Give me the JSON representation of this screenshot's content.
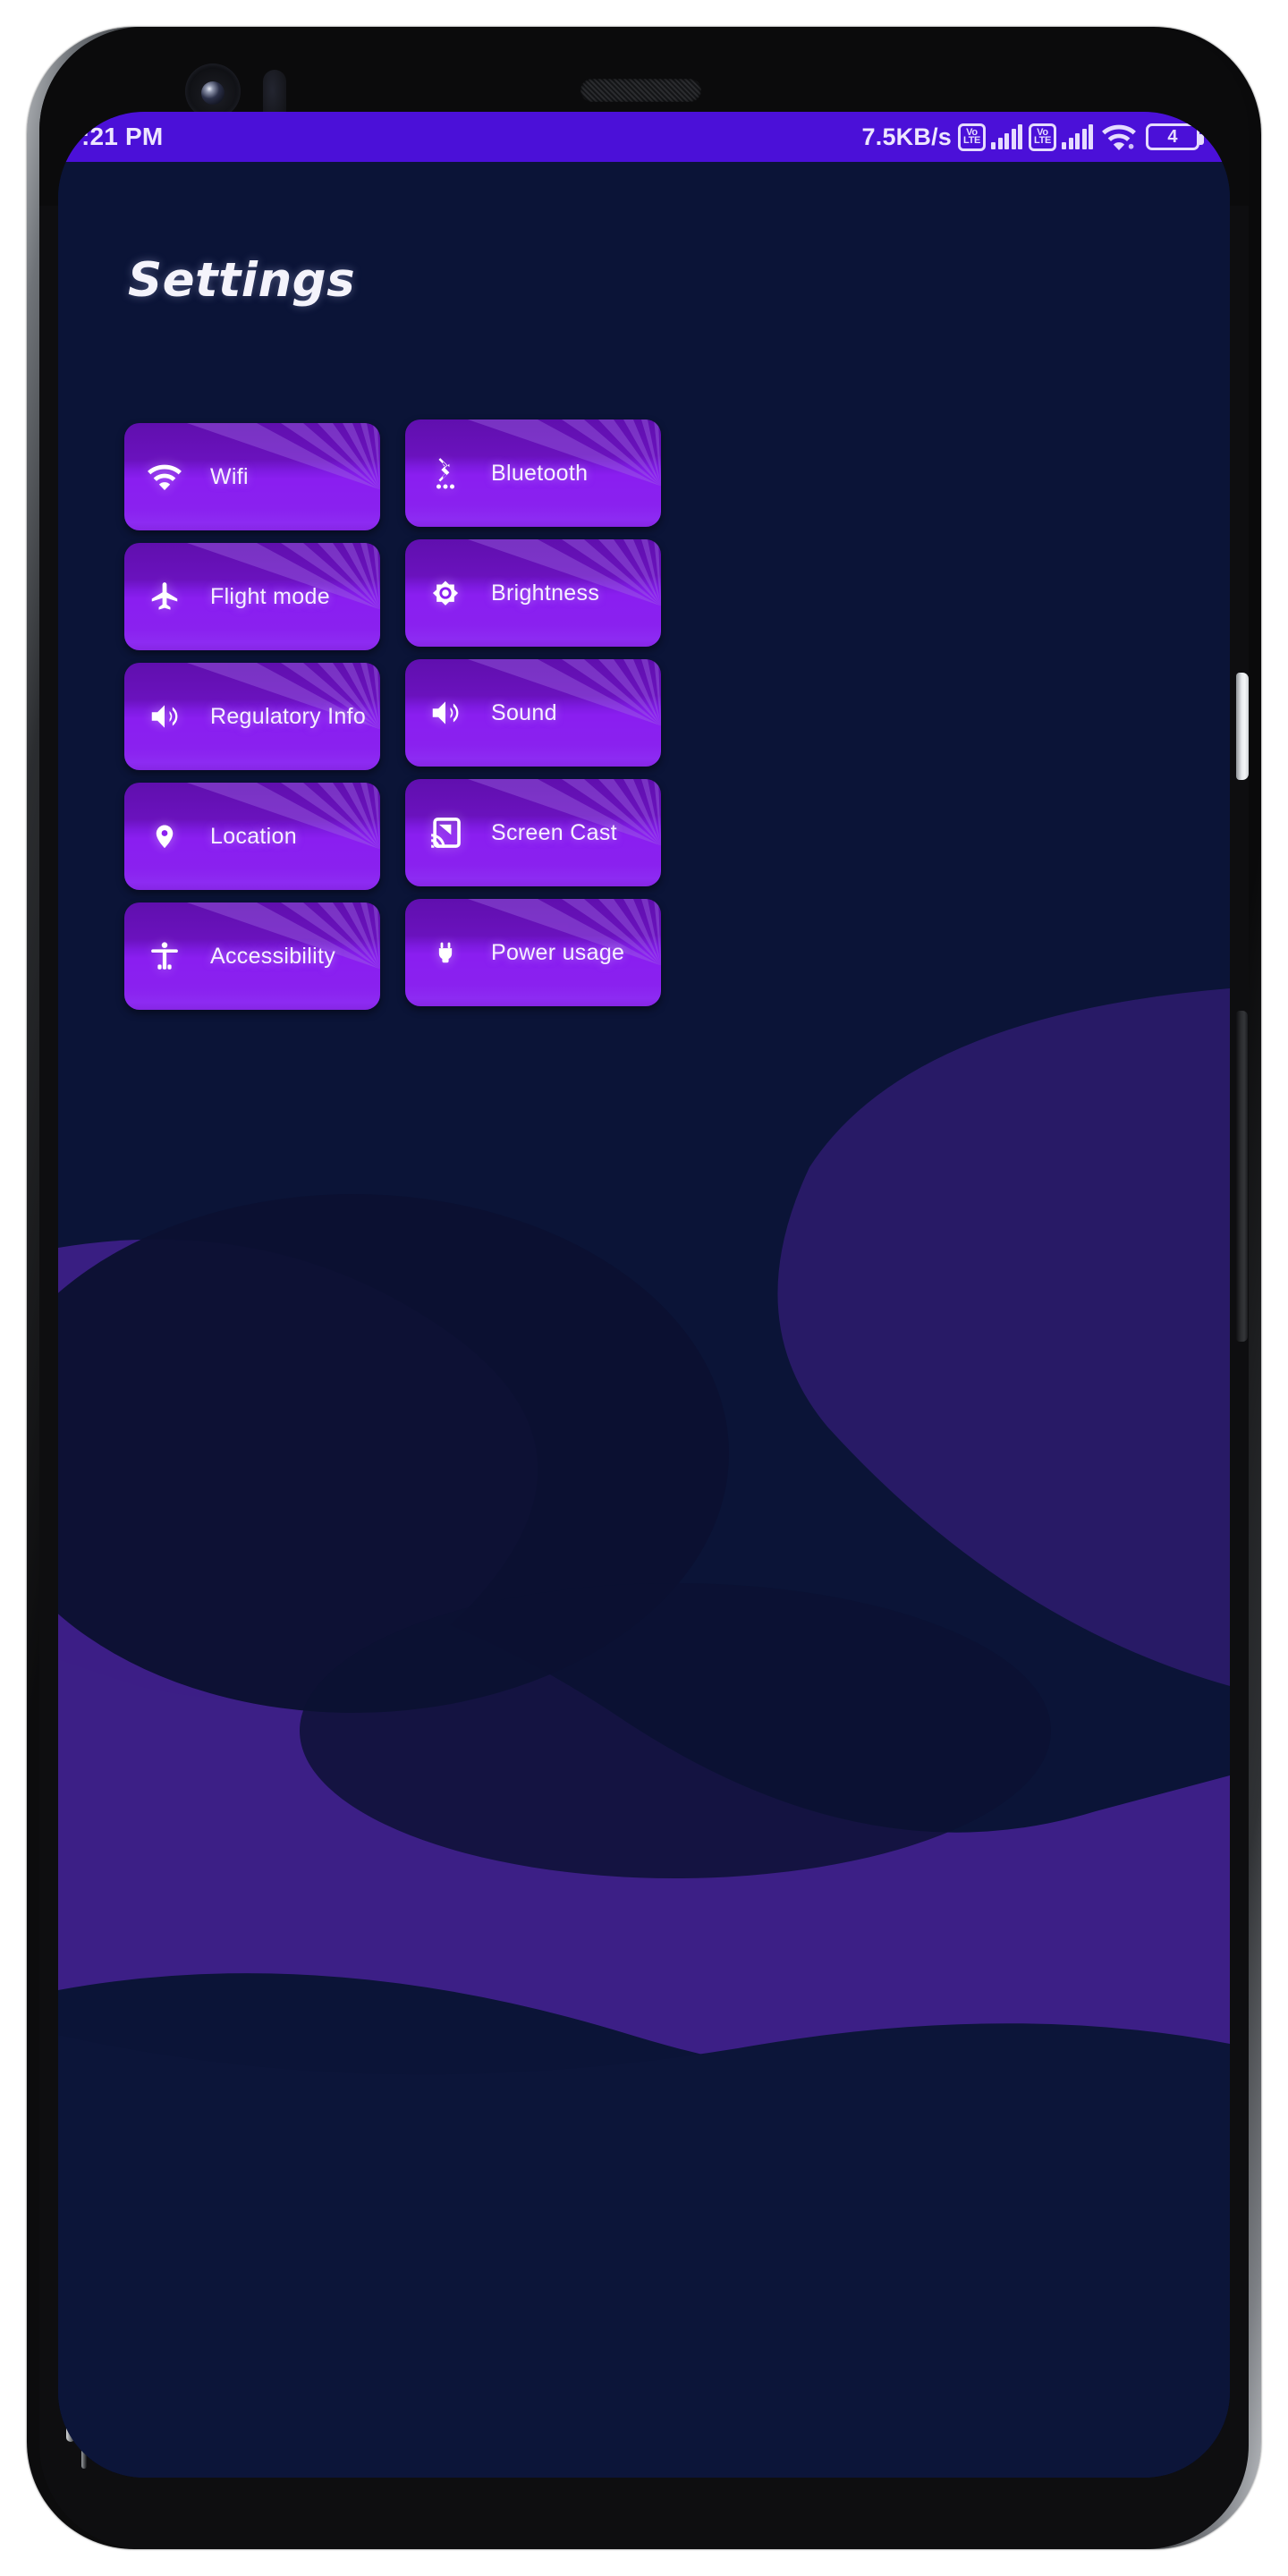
{
  "device": {
    "sensors": {
      "front_camera": "front-camera-icon",
      "proximity_sensor": "proximity-sensor-icon",
      "earpiece": "earpiece-speaker-grille"
    },
    "buttons": {
      "power": "power-button",
      "volume": "volume-rocker"
    }
  },
  "status_bar": {
    "clock": ":21 PM",
    "network_speed": "7.5KB/s",
    "sim1": {
      "volte_top": "Vo",
      "volte_bottom": "LTE",
      "signal_bars": 5
    },
    "sim2": {
      "volte_top": "Vo",
      "volte_bottom": "LTE",
      "signal_bars": 5
    },
    "wifi": "wifi-icon",
    "battery_level": "4",
    "background_color": "#4b10d8",
    "text_color": "#ede6ff"
  },
  "header": {
    "title": "Settings"
  },
  "theme": {
    "screen_background": "#0b1437",
    "blob_purple": "#3c1f86",
    "blob_dark": "#0b1132",
    "tile_top": "#600fae",
    "tile_mid": "#8a1ef0",
    "tile_bottom": "#8d2bf2",
    "ray_color": "#9b64e0",
    "label_color": "#f6f0ff"
  },
  "tiles": [
    {
      "label": "Wifi",
      "icon": "wifi-icon"
    },
    {
      "label": "Bluetooth",
      "icon": "bluetooth-searching-icon"
    },
    {
      "label": "Flight mode",
      "icon": "airplane-icon"
    },
    {
      "label": "Brightness",
      "icon": "brightness-sun-icon"
    },
    {
      "label": "Regulatory Info",
      "icon": "volume-up-icon"
    },
    {
      "label": "Sound",
      "icon": "volume-up-icon"
    },
    {
      "label": "Location",
      "icon": "map-pin-icon"
    },
    {
      "label": "Screen Cast",
      "icon": "screen-cast-icon"
    },
    {
      "label": "Accessibility",
      "icon": "accessibility-person-icon"
    },
    {
      "label": "Power usage",
      "icon": "power-plug-icon"
    }
  ]
}
